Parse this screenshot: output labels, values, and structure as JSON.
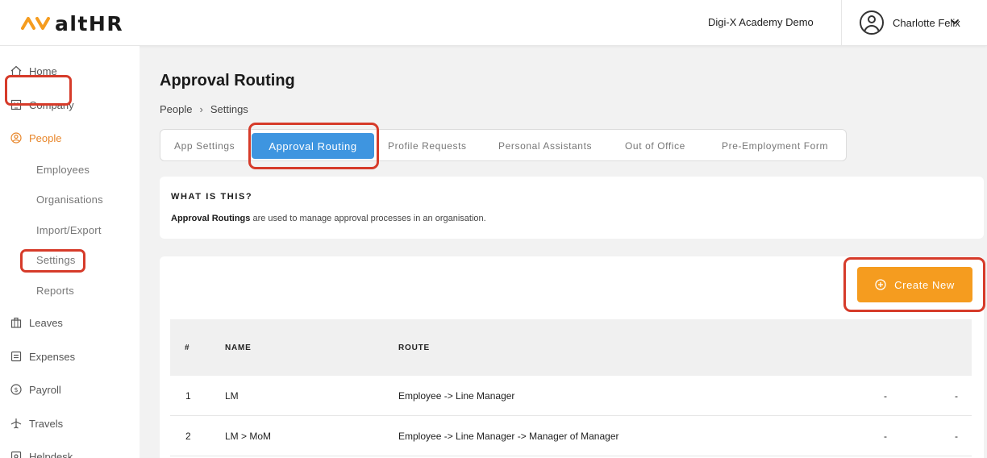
{
  "brand": {
    "logo_text": "altHR",
    "accent": "#f59c1f"
  },
  "header": {
    "org_name": "Digi-X Academy Demo",
    "user_name": "Charlotte Felix"
  },
  "sidebar": {
    "items": [
      {
        "label": "Home",
        "icon": "home-icon"
      },
      {
        "label": "Company",
        "icon": "building-icon"
      },
      {
        "label": "People",
        "icon": "person-circle-icon",
        "active": true
      },
      {
        "label": "Leaves",
        "icon": "luggage-icon"
      },
      {
        "label": "Expenses",
        "icon": "receipt-icon"
      },
      {
        "label": "Payroll",
        "icon": "dollar-circle-icon"
      },
      {
        "label": "Travels",
        "icon": "plane-icon"
      },
      {
        "label": "Helpdesk",
        "icon": "helpdesk-icon"
      }
    ],
    "people_subitems": [
      "Employees",
      "Organisations",
      "Import/Export",
      "Settings",
      "Reports"
    ]
  },
  "page": {
    "title": "Approval Routing",
    "breadcrumb": [
      "People",
      "Settings"
    ]
  },
  "tabs": [
    {
      "label": "App Settings"
    },
    {
      "label": "Approval Routing",
      "active": true
    },
    {
      "label": "Profile Requests"
    },
    {
      "label": "Personal Assistants"
    },
    {
      "label": "Out of Office"
    },
    {
      "label": "Pre-Employment Form"
    }
  ],
  "info": {
    "heading": "WHAT IS THIS?",
    "bold_term": "Approval Routings",
    "text_rest": " are used to manage approval processes in an organisation."
  },
  "actions": {
    "create_label": "Create New"
  },
  "table": {
    "columns": [
      "#",
      "NAME",
      "ROUTE"
    ],
    "rows": [
      {
        "num": "1",
        "name": "LM",
        "route": "Employee -> Line Manager",
        "c4": "-",
        "c5": "-"
      },
      {
        "num": "2",
        "name": "LM > MoM",
        "route": "Employee -> Line Manager -> Manager of Manager",
        "c4": "-",
        "c5": "-"
      }
    ]
  }
}
